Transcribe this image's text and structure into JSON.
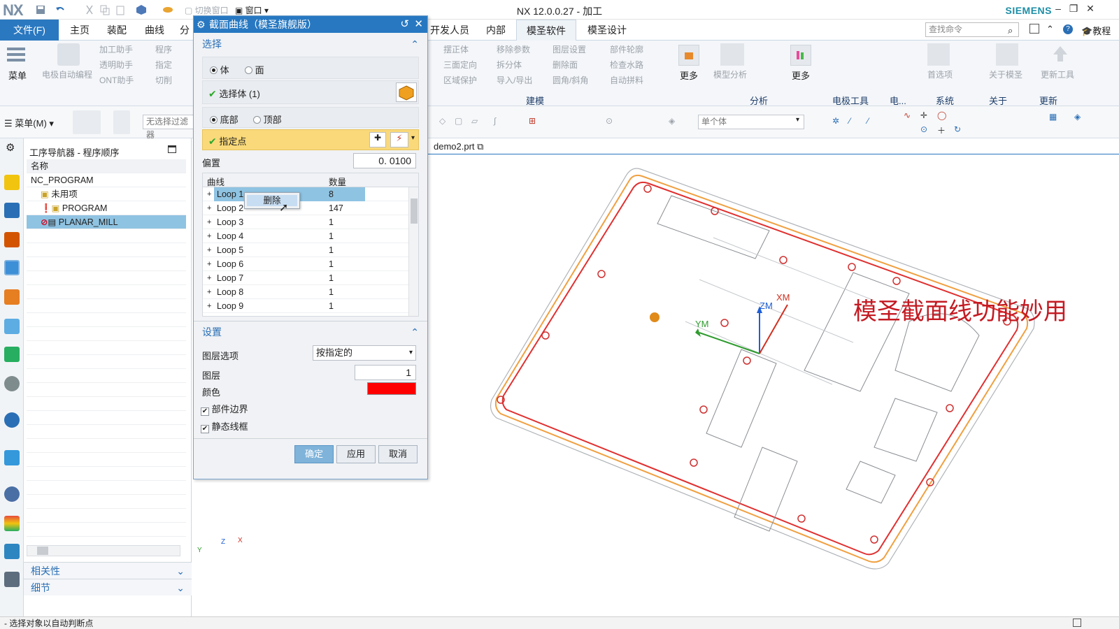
{
  "window": {
    "logo": "NX",
    "title": "NX 12.0.0.27 - 加工",
    "brand": "SIEMENS",
    "qat_window_switch": "切换窗口",
    "qat_window": "窗口"
  },
  "menu_tabs": {
    "file": "文件(F)",
    "tabs": [
      "主页",
      "装配",
      "曲线",
      "分",
      "开发人员",
      "内部",
      "模圣软件",
      "模圣设计"
    ],
    "active": "模圣软件",
    "search_placeholder": "查找命令",
    "tutorial": "教程"
  },
  "ribbon": {
    "menu_label": "菜单",
    "electrode_auto": "电极自动编程",
    "items_col1": [
      "加工助手",
      "透明助手",
      "ONT助手"
    ],
    "items_col2": [
      "程序",
      "指定",
      "切削"
    ],
    "items_col3": [
      "摆正体",
      "三面定向",
      "区域保护"
    ],
    "items_col4": [
      "移除参数",
      "拆分体",
      "导入/导出"
    ],
    "items_col5": [
      "图层设置",
      "删除面",
      "圆角/斜角"
    ],
    "items_col6": [
      "部件轮廓",
      "检查水路",
      "自动拼料"
    ],
    "more_1": "更多",
    "model_analysis": "模型分析",
    "more_2": "更多",
    "first_choice": "首选项",
    "about": "关于模圣",
    "update_tool": "更新工具",
    "group_labels": [
      "建模",
      "分析",
      "电极工具",
      "电...",
      "系统",
      "关于",
      "更新"
    ]
  },
  "toolbar2": {
    "menu_label": "菜单(M)",
    "filter": "无选择过滤器",
    "scope": "单个体"
  },
  "navigator": {
    "title": "工序导航器 - 程序顺序",
    "column_name": "名称",
    "rows": [
      "NC_PROGRAM",
      "未用项",
      "PROGRAM",
      "PLANAR_MILL"
    ],
    "collapse_1": "相关性",
    "collapse_2": "细节"
  },
  "dialog": {
    "title": "截面曲线（模圣旗舰版）",
    "section_select": "选择",
    "radio_body": "体",
    "radio_face": "面",
    "select_body": "选择体 (1)",
    "radio_bottom": "底部",
    "radio_top": "顶部",
    "specify_point": "指定点",
    "offset_label": "偏置",
    "offset_value": "0. 0100",
    "col_curve": "曲线",
    "col_count": "数量",
    "loops": [
      {
        "name": "Loop 1",
        "count": "8"
      },
      {
        "name": "Loop 2",
        "count": "147"
      },
      {
        "name": "Loop 3",
        "count": "1"
      },
      {
        "name": "Loop 4",
        "count": "1"
      },
      {
        "name": "Loop 5",
        "count": "1"
      },
      {
        "name": "Loop 6",
        "count": "1"
      },
      {
        "name": "Loop 7",
        "count": "1"
      },
      {
        "name": "Loop 8",
        "count": "1"
      },
      {
        "name": "Loop 9",
        "count": "1"
      }
    ],
    "context_menu_delete": "删除",
    "section_settings": "设置",
    "layer_option_label": "图层选项",
    "layer_option_value": "按指定的",
    "layer_label": "图层",
    "layer_value": "1",
    "color_label": "颜色",
    "color_value": "#ff0000",
    "cb_part_boundary": "部件边界",
    "cb_static_wireframe": "静态线框",
    "ok": "确定",
    "apply": "应用",
    "cancel": "取消"
  },
  "viewport": {
    "tab_name": "demo2.prt",
    "overlay_title": "模圣截面线功能妙用",
    "axis_xm": "XM",
    "axis_ym": "YM",
    "axis_zm": "ZM",
    "triad_x": "X",
    "triad_y": "Y",
    "triad_z": "Z"
  },
  "status": {
    "message": "- 选择对象以自动判断点"
  }
}
